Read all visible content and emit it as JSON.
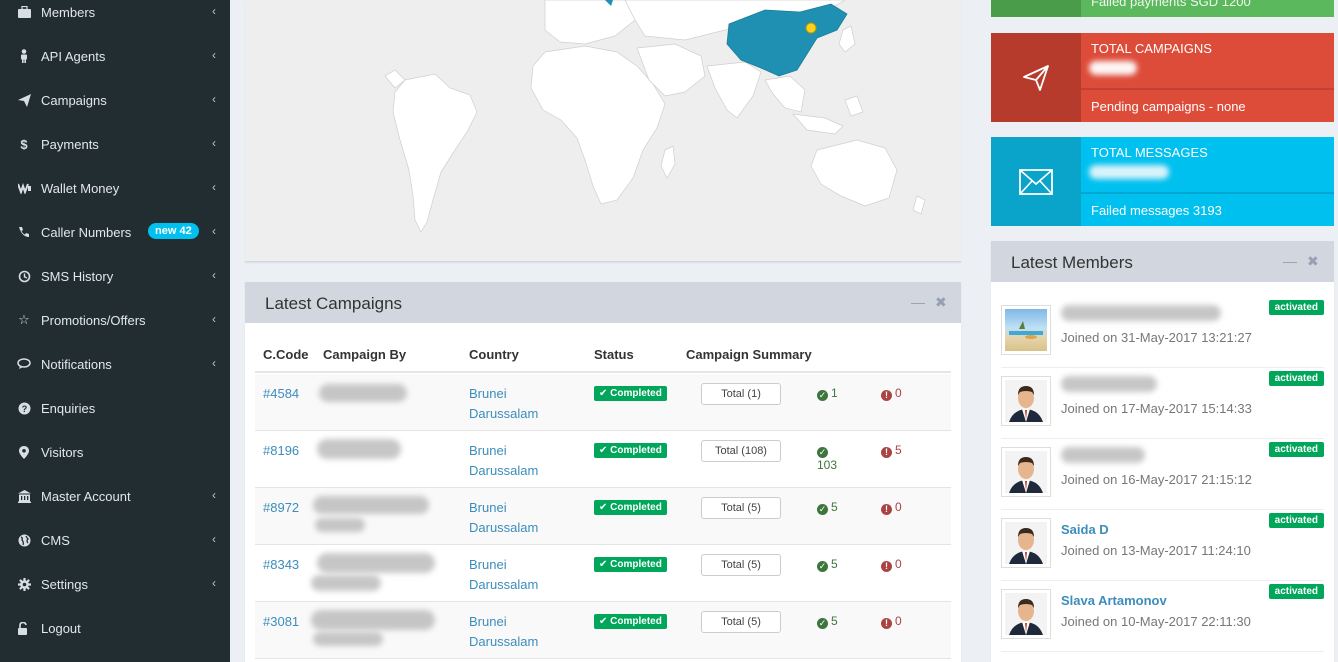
{
  "sidebar": {
    "items": [
      {
        "label": "Members",
        "icon": "briefcase-icon",
        "chevron": true
      },
      {
        "label": "API Agents",
        "icon": "person-icon",
        "chevron": true
      },
      {
        "label": "Campaigns",
        "icon": "paper-plane-icon",
        "chevron": true
      },
      {
        "label": "Payments",
        "icon": "dollar-icon",
        "chevron": true
      },
      {
        "label": "Wallet Money",
        "icon": "wallet-icon",
        "chevron": true
      },
      {
        "label": "Caller Numbers",
        "icon": "phone-icon",
        "chevron": true,
        "badge": "new 42"
      },
      {
        "label": "SMS History",
        "icon": "history-icon",
        "chevron": true
      },
      {
        "label": "Promotions/Offers",
        "icon": "star-icon",
        "chevron": true
      },
      {
        "label": "Notifications",
        "icon": "comment-icon",
        "chevron": true
      },
      {
        "label": "Enquiries",
        "icon": "question-icon",
        "chevron": false
      },
      {
        "label": "Visitors",
        "icon": "map-marker-icon",
        "chevron": false
      },
      {
        "label": "Master Account",
        "icon": "bank-icon",
        "chevron": true
      },
      {
        "label": "CMS",
        "icon": "globe-icon",
        "chevron": true
      },
      {
        "label": "Settings",
        "icon": "gear-icon",
        "chevron": true
      },
      {
        "label": "Logout",
        "icon": "unlock-icon",
        "chevron": false
      }
    ]
  },
  "campaigns": {
    "title": "Latest Campaigns",
    "headers": [
      "C.Code",
      "Campaign By",
      "Country",
      "Status",
      "Campaign Summary"
    ],
    "rows": [
      {
        "code": "#4584",
        "country1": "Brunei",
        "country2": "Darussalam",
        "status": "Completed",
        "total": "Total (1)",
        "ok": "1",
        "fail": "0"
      },
      {
        "code": "#8196",
        "country1": "Brunei",
        "country2": "Darussalam",
        "status": "Completed",
        "total": "Total (108)",
        "ok": "103",
        "fail": "5"
      },
      {
        "code": "#8972",
        "country1": "Brunei",
        "country2": "Darussalam",
        "status": "Completed",
        "total": "Total (5)",
        "ok": "5",
        "fail": "0"
      },
      {
        "code": "#8343",
        "country1": "Brunei",
        "country2": "Darussalam",
        "status": "Completed",
        "total": "Total (5)",
        "ok": "5",
        "fail": "0"
      },
      {
        "code": "#3081",
        "country1": "Brunei",
        "country2": "Darussalam",
        "status": "Completed",
        "total": "Total (5)",
        "ok": "5",
        "fail": "0"
      }
    ]
  },
  "info_boxes": {
    "payments_partial": "Failed payments SGD 1200",
    "campaigns_title": "TOTAL CAMPAIGNS",
    "campaigns_sub": "Pending campaigns - none",
    "messages_title": "TOTAL MESSAGES",
    "messages_sub": "Failed messages 3193",
    "colors": {
      "green": "#5cb85c",
      "red": "#dd4b39",
      "cyan": "#00c0ef"
    }
  },
  "members": {
    "title": "Latest Members",
    "items": [
      {
        "name": "",
        "joined": "Joined on 31-May-2017 13:21:27",
        "status": "activated",
        "avatar": "beach-photo"
      },
      {
        "name": "",
        "joined": "Joined on 17-May-2017 15:14:33",
        "status": "activated",
        "avatar": "default-user"
      },
      {
        "name": "",
        "joined": "Joined on 16-May-2017 21:15:12",
        "status": "activated",
        "avatar": "default-user"
      },
      {
        "name": "Saida D",
        "joined": "Joined on 13-May-2017 11:24:10",
        "status": "activated",
        "avatar": "default-user"
      },
      {
        "name": "Slava Artamonov",
        "joined": "Joined on 10-May-2017 22:11:30",
        "status": "activated",
        "avatar": "default-user"
      }
    ]
  }
}
